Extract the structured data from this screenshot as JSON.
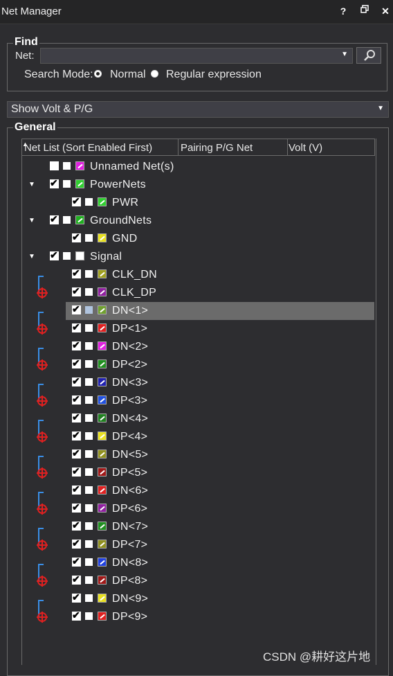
{
  "window": {
    "title": "Net Manager",
    "help": "?",
    "restore": "🗗",
    "close": "✕"
  },
  "find": {
    "group_label": "Find",
    "net_label": "Net:",
    "net_value": "",
    "search_mode_label": "Search Mode:",
    "mode_normal": "Normal",
    "mode_regex": "Regular expression",
    "selected_mode": "Normal"
  },
  "filter": {
    "value": "Show Volt & P/G"
  },
  "general": {
    "group_label": "General",
    "columns": [
      "Net List (Sort Enabled First)",
      "Pairing P/G Net",
      "Volt (V)"
    ]
  },
  "nets": [
    {
      "label": "Unnamed Net(s)",
      "color": "#e020e0"
    },
    {
      "label": "PowerNets",
      "color": "#30d030"
    },
    {
      "label": "PWR",
      "color": "#30d030"
    },
    {
      "label": "GroundNets",
      "color": "#20b020"
    },
    {
      "label": "GND",
      "color": "#e8e020"
    },
    {
      "label": "Signal",
      "color": "#ffffff"
    },
    {
      "label": "CLK_DN",
      "color": "#a0a020"
    },
    {
      "label": "CLK_DP",
      "color": "#9020a0"
    },
    {
      "label": "DN<1>",
      "color": "#70a030"
    },
    {
      "label": "DP<1>",
      "color": "#e02020"
    },
    {
      "label": "DN<2>",
      "color": "#e020e0"
    },
    {
      "label": "DP<2>",
      "color": "#209020"
    },
    {
      "label": "DN<3>",
      "color": "#2020b0"
    },
    {
      "label": "DP<3>",
      "color": "#2050e0"
    },
    {
      "label": "DN<4>",
      "color": "#208020"
    },
    {
      "label": "DP<4>",
      "color": "#e8e020"
    },
    {
      "label": "DN<5>",
      "color": "#909020"
    },
    {
      "label": "DP<5>",
      "color": "#a01818"
    },
    {
      "label": "DN<6>",
      "color": "#e02020"
    },
    {
      "label": "DP<6>",
      "color": "#9020a0"
    },
    {
      "label": "DN<7>",
      "color": "#209020"
    },
    {
      "label": "DP<7>",
      "color": "#909020"
    },
    {
      "label": "DN<8>",
      "color": "#2040e0"
    },
    {
      "label": "DP<8>",
      "color": "#a01818"
    },
    {
      "label": "DN<9>",
      "color": "#e8e020"
    },
    {
      "label": "DP<9>",
      "color": "#e02020"
    }
  ],
  "watermark": "CSDN @耕好这片地"
}
